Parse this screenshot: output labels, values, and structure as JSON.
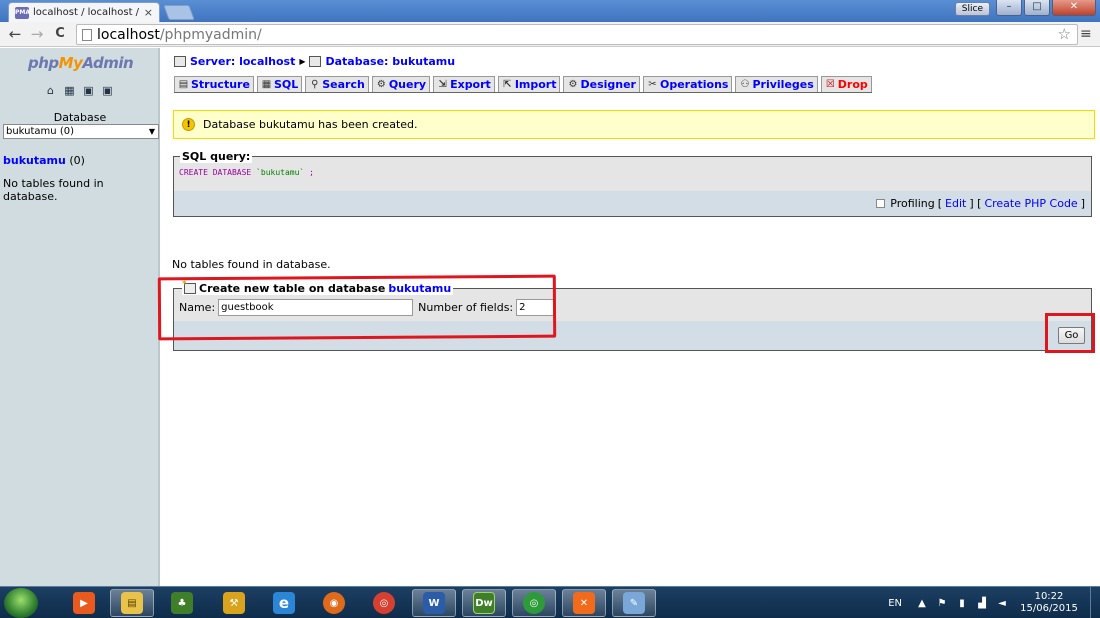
{
  "browser": {
    "tab_title": "localhost / localhost / buk",
    "tab_close": "×",
    "slice_label": "Slice",
    "url_host": "localhost",
    "url_path": "/phpmyadmin/",
    "back": "←",
    "forward": "→",
    "reload": "C",
    "star": "☆",
    "menu": "≡",
    "minimize": "–",
    "maximize": "□",
    "close": "✕"
  },
  "left": {
    "logo_php": "php",
    "logo_my": "My",
    "logo_admin": "Admin",
    "database_label": "Database",
    "database_select": "bukutamu (0)",
    "db_name": "bukutamu",
    "db_count": "(0)",
    "no_tables": "No tables found in database."
  },
  "breadcrumb": {
    "server": "Server: localhost",
    "database": "Database: bukutamu"
  },
  "tabs": [
    {
      "label": "Structure",
      "icon": "structure-icon"
    },
    {
      "label": "SQL",
      "icon": "sql-icon"
    },
    {
      "label": "Search",
      "icon": "search-icon"
    },
    {
      "label": "Query",
      "icon": "query-icon"
    },
    {
      "label": "Export",
      "icon": "export-icon"
    },
    {
      "label": "Import",
      "icon": "import-icon"
    },
    {
      "label": "Designer",
      "icon": "designer-icon"
    },
    {
      "label": "Operations",
      "icon": "operations-icon"
    },
    {
      "label": "Privileges",
      "icon": "privileges-icon"
    },
    {
      "label": "Drop",
      "icon": "drop-icon"
    }
  ],
  "notice": {
    "message": "Database bukutamu has been created."
  },
  "sql": {
    "legend": "SQL query:",
    "keyword": "CREATE DATABASE",
    "value": "`bukutamu`",
    "terminator": " ;",
    "profiling": "Profiling",
    "edit": "Edit",
    "create_php": "Create PHP Code",
    "open_bracket": "[",
    "close_bracket": "]",
    "mid_bracket": "] [",
    "lead_bracket": "["
  },
  "main": {
    "no_tables": "No tables found in database."
  },
  "create_table": {
    "legend_text": "Create new table on database",
    "legend_db": "bukutamu",
    "name_label": "Name:",
    "name_value": "guestbook",
    "fields_label": "Number of fields:",
    "fields_value": "2",
    "go_label": "Go"
  },
  "taskbar": {
    "lang": "EN",
    "time": "10:22",
    "date": "15/06/2015",
    "apps": [
      {
        "name": "media-player-icon",
        "glyph": "▶"
      },
      {
        "name": "file-explorer-icon",
        "glyph": "▤"
      },
      {
        "name": "plant-icon",
        "glyph": "♣"
      },
      {
        "name": "tool-icon",
        "glyph": "⚒"
      },
      {
        "name": "internet-explorer-icon",
        "glyph": "e"
      },
      {
        "name": "firefox-icon",
        "glyph": "◉"
      },
      {
        "name": "chrome-icon",
        "glyph": "◎"
      },
      {
        "name": "word-icon",
        "glyph": "W"
      },
      {
        "name": "dreamweaver-icon",
        "glyph": "Dw"
      },
      {
        "name": "chrome-active-icon",
        "glyph": "◎"
      },
      {
        "name": "xampp-icon",
        "glyph": "✕"
      },
      {
        "name": "paint-icon",
        "glyph": "✎"
      }
    ]
  }
}
